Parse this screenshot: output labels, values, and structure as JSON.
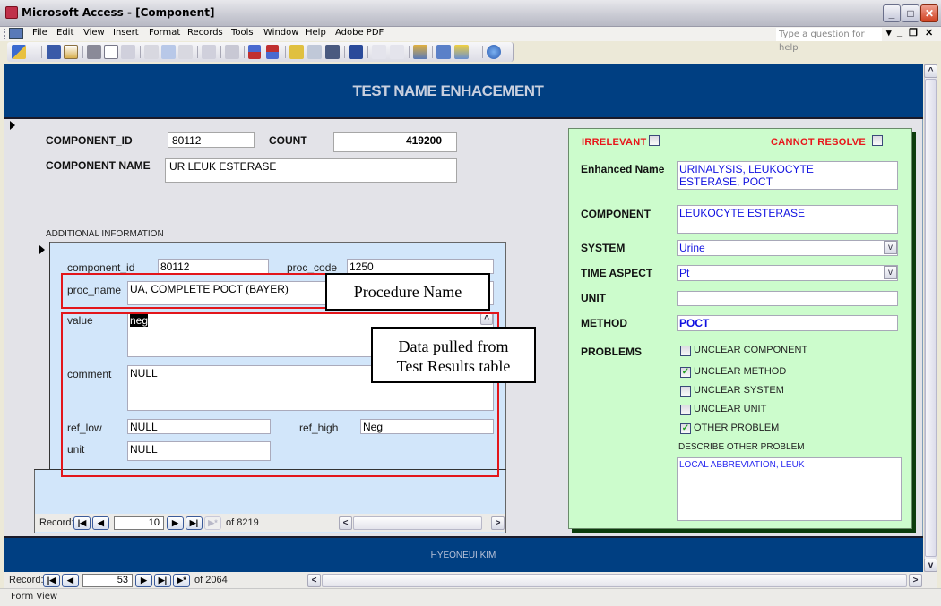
{
  "window": {
    "title": "Microsoft Access - [Component]",
    "controls": {
      "minimize": "_",
      "maximize": "□",
      "close": "✕"
    }
  },
  "menubar": {
    "items": [
      "File",
      "Edit",
      "View",
      "Insert",
      "Format",
      "Records",
      "Tools",
      "Window",
      "Help",
      "Adobe PDF"
    ],
    "help_placeholder": "Type a question for help",
    "mdi_controls": [
      "▾",
      "_",
      "❐",
      "✕"
    ]
  },
  "toolbar": {
    "icons": [
      "design-view-icon",
      "save-icon",
      "file-search-icon",
      "print-icon",
      "print-preview-icon",
      "spelling-icon",
      "cut-icon",
      "copy-icon",
      "paste-icon",
      "undo-icon",
      "hyperlink-icon",
      "sort-ascending-icon",
      "sort-descending-icon",
      "filter-by-selection-icon",
      "filter-by-form-icon",
      "apply-filter-icon",
      "find-icon",
      "new-record-icon",
      "delete-record-icon",
      "properties-icon",
      "database-window-icon",
      "new-object-icon",
      "help-icon"
    ]
  },
  "form": {
    "header_title": "TEST NAME ENHACEMENT",
    "component_id_label": "COMPONENT_ID",
    "component_id_value": "80112",
    "count_label": "COUNT",
    "count_value": "419200",
    "component_name_label": "COMPONENT  NAME",
    "component_name_value": "UR LEUK ESTERASE",
    "additional_info_label": "ADDITIONAL INFORMATION",
    "footer_text": "HYEONEUI KIM"
  },
  "subform": {
    "fields": {
      "component_id": {
        "label": "component_id",
        "value": "80112"
      },
      "proc_code": {
        "label": "proc_code",
        "value": "1250"
      },
      "proc_name": {
        "label": "proc_name",
        "value": "UA, COMPLETE POCT (BAYER)"
      },
      "value": {
        "label": "value",
        "value": "neg"
      },
      "comment": {
        "label": "comment",
        "value": "NULL"
      },
      "ref_low": {
        "label": "ref_low",
        "value": "NULL"
      },
      "ref_high": {
        "label": "ref_high",
        "value": "Neg"
      },
      "unit": {
        "label": "unit",
        "value": "NULL"
      }
    },
    "nav": {
      "label": "Record:",
      "current": "10",
      "total_text": "of 8219"
    }
  },
  "annotations": {
    "procedure_name": "Procedure Name",
    "data_pulled_line1": "Data pulled from",
    "data_pulled_line2": "Test Results table"
  },
  "enhancement_panel": {
    "irrelevant_label": "IRRELEVANT",
    "irrelevant_checked": false,
    "cannot_resolve_label": "CANNOT RESOLVE",
    "cannot_resolve_checked": false,
    "enhanced_name_label": "Enhanced Name",
    "enhanced_name_line1": "URINALYSIS, LEUKOCYTE",
    "enhanced_name_line2": "ESTERASE, POCT",
    "component_label": "COMPONENT",
    "component_value": "LEUKOCYTE ESTERASE",
    "system_label": "SYSTEM",
    "system_value": "Urine",
    "time_aspect_label": "TIME ASPECT",
    "time_aspect_value": "Pt",
    "unit_label": "UNIT",
    "unit_value": "",
    "method_label": "METHOD",
    "method_value": "POCT",
    "problems_label": "PROBLEMS",
    "problems": [
      {
        "label": "UNCLEAR COMPONENT",
        "checked": false
      },
      {
        "label": "UNCLEAR METHOD",
        "checked": true
      },
      {
        "label": "UNCLEAR SYSTEM",
        "checked": false
      },
      {
        "label": "UNCLEAR UNIT",
        "checked": false
      },
      {
        "label": "OTHER PROBLEM",
        "checked": true
      }
    ],
    "describe_label": "DESCRIBE OTHER PROBLEM",
    "describe_value": "LOCAL ABBREVIATION, LEUK"
  },
  "main_nav": {
    "label": "Record:",
    "current": "53",
    "total_text": "of 2064"
  },
  "statusbar": {
    "text": "Form View"
  },
  "glyphs": {
    "first": "|◀",
    "prev": "◀",
    "next": "▶",
    "last": "▶|",
    "new": "▶*",
    "scroll_left": "<",
    "scroll_right": ">",
    "scroll_up": "^",
    "scroll_down": "v",
    "combo": "v",
    "check": "✓",
    "grip": "|||"
  },
  "colors": {
    "header_band": "#003f82",
    "green_panel": "#ccfccc",
    "subform_bg": "#d2e6fa",
    "annotation_red": "#e3161b",
    "field_blue_text": "#1010e0",
    "flag_red": "#e8141a"
  }
}
